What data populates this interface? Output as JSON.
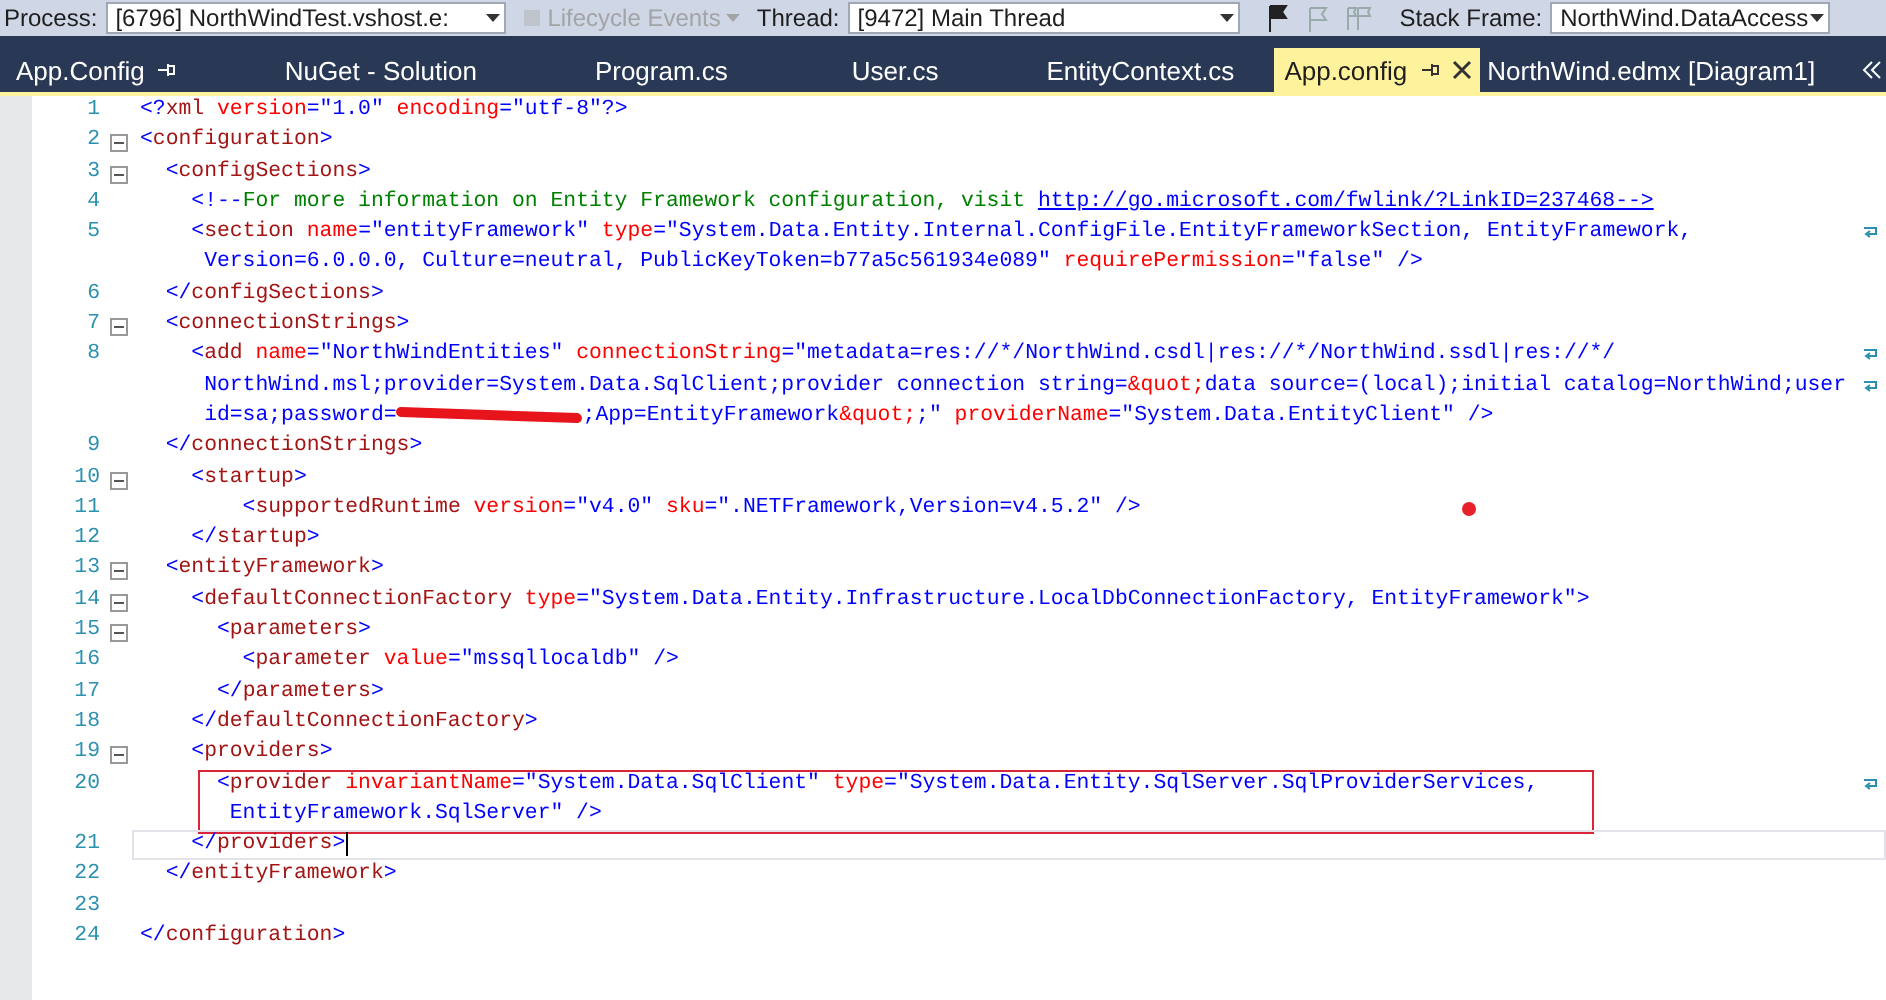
{
  "toolbar": [
    {
      "kind": "label",
      "text": "Process:"
    },
    {
      "kind": "combo",
      "value": "[6796] NorthWindTest.vshost.e:"
    },
    {
      "kind": "button",
      "text": "Lifecycle Events",
      "disabled": true
    },
    {
      "kind": "label",
      "text": "Thread:"
    },
    {
      "kind": "combo",
      "value": "[9472] Main Thread"
    },
    {
      "kind": "flags"
    },
    {
      "kind": "label",
      "text": "Stack Frame:"
    },
    {
      "kind": "combo",
      "value": "NorthWind.DataAccess"
    }
  ],
  "tabs": [
    {
      "label": "App.Config",
      "selected": false,
      "pinned": true
    },
    {
      "label": "NuGet - Solution",
      "selected": false,
      "pinned": false
    },
    {
      "label": "Program.cs",
      "selected": false,
      "pinned": false
    },
    {
      "label": "User.cs",
      "selected": false,
      "pinned": false
    },
    {
      "label": "EntityContext.cs",
      "selected": false,
      "pinned": false
    },
    {
      "label": "App.config",
      "selected": true,
      "pinned": false
    },
    {
      "label": "NorthWind.edmx [Diagram1]",
      "selected": false,
      "pinned": false
    }
  ],
  "editor": {
    "lines": [
      {
        "number": "1",
        "foldable": false,
        "rows": [
          {
            "segments": [
              {
                "kind": "markup",
                "text": "<?"
              },
              {
                "kind": "element",
                "text": "xml"
              },
              {
                "kind": "attribute",
                "text": " version"
              },
              {
                "kind": "markup",
                "text": "=\"1.0\""
              },
              {
                "kind": "attribute",
                "text": " encoding"
              },
              {
                "kind": "markup",
                "text": "=\"utf-8\"?>"
              }
            ]
          }
        ]
      },
      {
        "number": "2",
        "foldable": true,
        "rows": [
          {
            "segments": [
              {
                "kind": "markup",
                "text": "<"
              },
              {
                "kind": "element",
                "text": "configuration"
              },
              {
                "kind": "markup",
                "text": ">"
              }
            ]
          }
        ]
      },
      {
        "number": "3",
        "foldable": true,
        "rows": [
          {
            "segments": [
              {
                "kind": "markup",
                "text": "  <"
              },
              {
                "kind": "element",
                "text": "configSections"
              },
              {
                "kind": "markup",
                "text": ">"
              }
            ]
          }
        ]
      },
      {
        "number": "4",
        "foldable": false,
        "rows": [
          {
            "segments": [
              {
                "kind": "markup",
                "text": "    <!--"
              },
              {
                "kind": "comment",
                "text": "For more information on Entity Framework configuration, visit "
              },
              {
                "kind": "link",
                "text": "http://go.microsoft.com/fwlink/?LinkID=237468-->"
              }
            ]
          }
        ]
      },
      {
        "number": "5",
        "foldable": false,
        "rows": [
          {
            "segments": [
              {
                "kind": "markup",
                "text": "    <"
              },
              {
                "kind": "element",
                "text": "section"
              },
              {
                "kind": "attribute",
                "text": " name"
              },
              {
                "kind": "markup",
                "text": "=\"entityFramework\""
              },
              {
                "kind": "attribute",
                "text": " type"
              },
              {
                "kind": "markup",
                "text": "=\"System.Data.Entity.Internal.ConfigFile.EntityFrameworkSection, EntityFramework,"
              }
            ]
          },
          {
            "segments": [
              {
                "kind": "markup",
                "text": "     Version=6.0.0.0, Culture=neutral, PublicKeyToken=b77a5c561934e089\""
              },
              {
                "kind": "attribute",
                "text": " requirePermission"
              },
              {
                "kind": "markup",
                "text": "=\"false\" />"
              }
            ]
          }
        ]
      },
      {
        "number": "6",
        "foldable": false,
        "rows": [
          {
            "segments": [
              {
                "kind": "markup",
                "text": "  </"
              },
              {
                "kind": "element",
                "text": "configSections"
              },
              {
                "kind": "markup",
                "text": ">"
              }
            ]
          }
        ]
      },
      {
        "number": "7",
        "foldable": true,
        "rows": [
          {
            "segments": [
              {
                "kind": "markup",
                "text": "  <"
              },
              {
                "kind": "element",
                "text": "connectionStrings"
              },
              {
                "kind": "markup",
                "text": ">"
              }
            ]
          }
        ]
      },
      {
        "number": "8",
        "foldable": false,
        "rows": [
          {
            "segments": [
              {
                "kind": "markup",
                "text": "    <"
              },
              {
                "kind": "element",
                "text": "add"
              },
              {
                "kind": "attribute",
                "text": " name"
              },
              {
                "kind": "markup",
                "text": "=\"NorthWindEntities\""
              },
              {
                "kind": "attribute",
                "text": " connectionString"
              },
              {
                "kind": "markup",
                "text": "=\"metadata=res://*/NorthWind.csdl|res://*/NorthWind.ssdl|res://*/"
              }
            ]
          },
          {
            "segments": [
              {
                "kind": "markup",
                "text": "     NorthWind.msl;provider=System.Data.SqlClient;provider connection string="
              },
              {
                "kind": "attribute",
                "text": "&quot;"
              },
              {
                "kind": "markup",
                "text": "data source=(local);initial catalog=NorthWind;user"
              }
            ]
          },
          {
            "segments": [
              {
                "kind": "markup",
                "text": "     id=sa;password="
              },
              {
                "kind": "redaction"
              },
              {
                "kind": "markup",
                "text": ";App=EntityFramework"
              },
              {
                "kind": "attribute",
                "text": "&quot;"
              },
              {
                "kind": "markup",
                "text": ";\""
              },
              {
                "kind": "attribute",
                "text": " providerName"
              },
              {
                "kind": "markup",
                "text": "=\"System.Data.EntityClient\" />"
              }
            ]
          }
        ]
      },
      {
        "number": "9",
        "foldable": false,
        "rows": [
          {
            "segments": [
              {
                "kind": "markup",
                "text": "  </"
              },
              {
                "kind": "element",
                "text": "connectionStrings"
              },
              {
                "kind": "markup",
                "text": ">"
              }
            ]
          }
        ]
      },
      {
        "number": "10",
        "foldable": true,
        "rows": [
          {
            "segments": [
              {
                "kind": "markup",
                "text": "    <"
              },
              {
                "kind": "element",
                "text": "startup"
              },
              {
                "kind": "markup",
                "text": ">"
              }
            ]
          }
        ]
      },
      {
        "number": "11",
        "foldable": false,
        "marked": true,
        "rows": [
          {
            "segments": [
              {
                "kind": "markup",
                "text": "        <"
              },
              {
                "kind": "element",
                "text": "supportedRuntime"
              },
              {
                "kind": "attribute",
                "text": " version"
              },
              {
                "kind": "markup",
                "text": "=\"v4.0\""
              },
              {
                "kind": "attribute",
                "text": " sku"
              },
              {
                "kind": "markup",
                "text": "=\".NETFramework,Version=v4.5.2\" />"
              }
            ]
          }
        ]
      },
      {
        "number": "12",
        "foldable": false,
        "rows": [
          {
            "segments": [
              {
                "kind": "markup",
                "text": "    </"
              },
              {
                "kind": "element",
                "text": "startup"
              },
              {
                "kind": "markup",
                "text": ">"
              }
            ]
          }
        ]
      },
      {
        "number": "13",
        "foldable": true,
        "rows": [
          {
            "segments": [
              {
                "kind": "markup",
                "text": "  <"
              },
              {
                "kind": "element",
                "text": "entityFramework"
              },
              {
                "kind": "markup",
                "text": ">"
              }
            ]
          }
        ]
      },
      {
        "number": "14",
        "foldable": true,
        "rows": [
          {
            "segments": [
              {
                "kind": "markup",
                "text": "    <"
              },
              {
                "kind": "element",
                "text": "defaultConnectionFactory"
              },
              {
                "kind": "attribute",
                "text": " type"
              },
              {
                "kind": "markup",
                "text": "=\"System.Data.Entity.Infrastructure.LocalDbConnectionFactory, EntityFramework\">"
              }
            ]
          }
        ]
      },
      {
        "number": "15",
        "foldable": true,
        "rows": [
          {
            "segments": [
              {
                "kind": "markup",
                "text": "      <"
              },
              {
                "kind": "element",
                "text": "parameters"
              },
              {
                "kind": "markup",
                "text": ">"
              }
            ]
          }
        ]
      },
      {
        "number": "16",
        "foldable": false,
        "rows": [
          {
            "segments": [
              {
                "kind": "markup",
                "text": "        <"
              },
              {
                "kind": "element",
                "text": "parameter"
              },
              {
                "kind": "attribute",
                "text": " value"
              },
              {
                "kind": "markup",
                "text": "=\"mssqllocaldb\" />"
              }
            ]
          }
        ]
      },
      {
        "number": "17",
        "foldable": false,
        "rows": [
          {
            "segments": [
              {
                "kind": "markup",
                "text": "      </"
              },
              {
                "kind": "element",
                "text": "parameters"
              },
              {
                "kind": "markup",
                "text": ">"
              }
            ]
          }
        ]
      },
      {
        "number": "18",
        "foldable": false,
        "rows": [
          {
            "segments": [
              {
                "kind": "markup",
                "text": "    </"
              },
              {
                "kind": "element",
                "text": "defaultConnectionFactory"
              },
              {
                "kind": "markup",
                "text": ">"
              }
            ]
          }
        ]
      },
      {
        "number": "19",
        "foldable": true,
        "rows": [
          {
            "segments": [
              {
                "kind": "markup",
                "text": "    <"
              },
              {
                "kind": "element",
                "text": "providers"
              },
              {
                "kind": "markup",
                "text": ">"
              }
            ]
          }
        ]
      },
      {
        "number": "20",
        "foldable": false,
        "boxed": true,
        "rows": [
          {
            "segments": [
              {
                "kind": "markup",
                "text": "      <"
              },
              {
                "kind": "element",
                "text": "provider"
              },
              {
                "kind": "attribute",
                "text": " invariantName"
              },
              {
                "kind": "markup",
                "text": "=\"System.Data.SqlClient\""
              },
              {
                "kind": "attribute",
                "text": " type"
              },
              {
                "kind": "markup",
                "text": "=\"System.Data.Entity.SqlServer.SqlProviderServices,"
              }
            ]
          },
          {
            "segments": [
              {
                "kind": "markup",
                "text": "       EntityFramework.SqlServer\" />"
              }
            ]
          }
        ]
      },
      {
        "number": "21",
        "foldable": false,
        "current": true,
        "rows": [
          {
            "segments": [
              {
                "kind": "markup",
                "text": "    </"
              },
              {
                "kind": "element",
                "text": "providers"
              },
              {
                "kind": "markup",
                "text": ">"
              }
            ]
          }
        ]
      },
      {
        "number": "22",
        "foldable": false,
        "rows": [
          {
            "segments": [
              {
                "kind": "markup",
                "text": "  </"
              },
              {
                "kind": "element",
                "text": "entityFramework"
              },
              {
                "kind": "markup",
                "text": ">"
              }
            ]
          }
        ]
      },
      {
        "number": "23",
        "foldable": false,
        "rows": [
          {}
        ]
      },
      {
        "number": "24",
        "foldable": false,
        "rows": [
          {
            "segments": [
              {
                "kind": "markup",
                "text": "</"
              },
              {
                "kind": "element",
                "text": "configuration"
              },
              {
                "kind": "markup",
                "text": ">"
              }
            ]
          }
        ]
      }
    ]
  }
}
